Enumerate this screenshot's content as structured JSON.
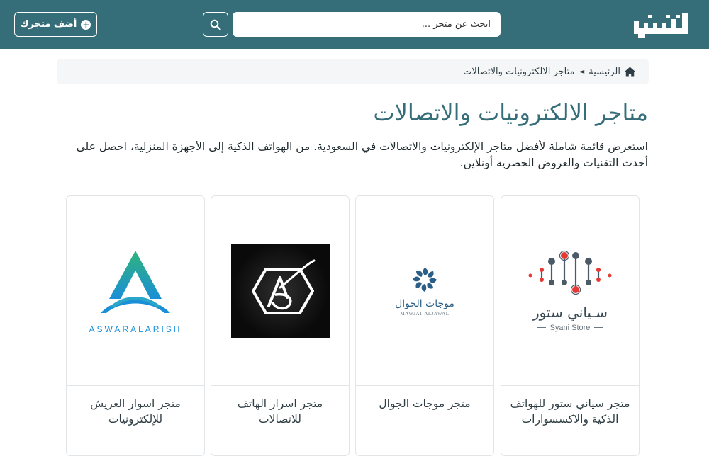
{
  "header": {
    "logo_icon": "site-logo-icon",
    "search_placeholder": "ابحث عن متجر ...",
    "search_icon": "search-icon",
    "add_store_label": "أضف متجرك",
    "add_icon": "plus-circle-icon",
    "bg_color": "#356e78"
  },
  "breadcrumb": {
    "home_label": "الرئيسية",
    "home_icon": "home-icon",
    "separator": "◄",
    "current": "متاجر الالكترونيات والاتصالات"
  },
  "page": {
    "title": "متاجر الالكترونيات والاتصالات",
    "description": "استعرض قائمة شاملة لأفضل متاجر الإلكترونيات والاتصالات في السعودية. من الهواتف الذكية إلى الأجهزة المنزلية، احصل على أحدث التقنيات والعروض الحصرية أونلاين."
  },
  "stores": [
    {
      "name": "متجر سياني ستور للهواتف الذكية والاكسسوارات",
      "logo_icon": "syani-store-logo",
      "logo_text_ar": "سـياني ستور",
      "logo_text_en": "Syani Store"
    },
    {
      "name": "متجر موجات الجوال",
      "logo_icon": "mawjat-aljawal-logo",
      "logo_text_ar": "موجات الجوال",
      "logo_text_en": "MAWJAT-ALJAWAL"
    },
    {
      "name": "متجر اسرار الهاتف للاتصالات",
      "logo_icon": "asrar-alhatif-logo"
    },
    {
      "name": "متجر اسوار العريش للإلكترونيات",
      "logo_icon": "aswar-alarish-logo",
      "logo_text_en": "ASWARALARISH"
    }
  ]
}
